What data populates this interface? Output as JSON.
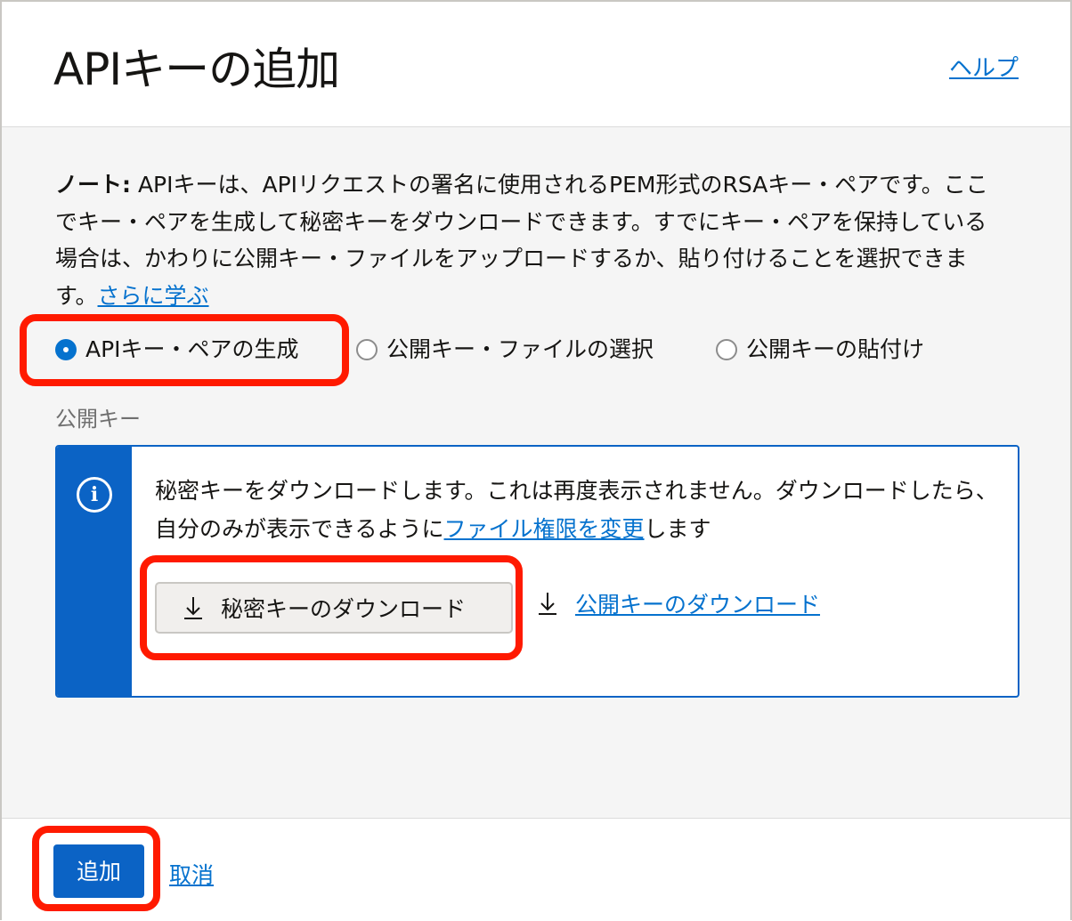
{
  "dialog": {
    "title": "APIキーの追加",
    "help_label": "ヘルプ"
  },
  "note": {
    "label": "ノート:",
    "text": " APIキーは、APIリクエストの署名に使用されるPEM形式のRSAキー・ペアです。ここでキー・ペアを生成して秘密キーをダウンロードできます。すでにキー・ペアを保持している場合は、かわりに公開キー・ファイルをアップロードするか、貼り付けることを選択できます。",
    "learn_more": "さらに学ぶ"
  },
  "options": {
    "generate": "APIキー・ペアの生成",
    "choose_file": "公開キー・ファイルの選択",
    "paste": "公開キーの貼付け",
    "selected": "generate"
  },
  "public_key": {
    "label": "公開キー"
  },
  "info": {
    "text": "秘密キーをダウンロードします。これは再度表示されません。ダウンロードしたら、自分のみが表示できるように",
    "link": "ファイル権限を変更",
    "text_after": "します",
    "download_private": "秘密キーのダウンロード",
    "download_public": "公開キーのダウンロード"
  },
  "footer": {
    "add_label": "追加",
    "cancel_label": "取消"
  },
  "colors": {
    "accent": "#0572ce",
    "primary_button": "#0b63c5",
    "highlight": "#ff1a00"
  },
  "icons": {
    "info": "info-icon",
    "download": "download-arrow-icon"
  }
}
